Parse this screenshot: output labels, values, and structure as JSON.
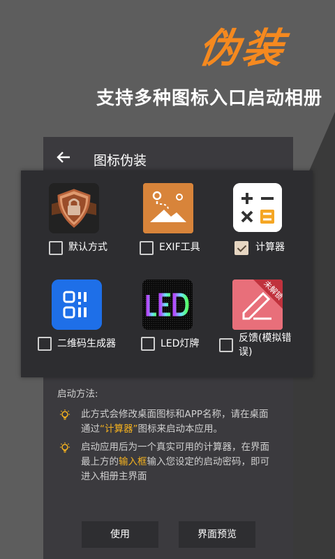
{
  "hero": {
    "title": "伪装",
    "subtitle": "支持多种图标入口启动相册"
  },
  "screen": {
    "title": "图标伪装"
  },
  "icons": [
    {
      "label": "默认方式",
      "checked": false,
      "icon": "shield-lock-icon"
    },
    {
      "label": "EXIF工具",
      "checked": false,
      "icon": "map-image-icon"
    },
    {
      "label": "计算器",
      "checked": true,
      "icon": "calculator-icon"
    },
    {
      "label": "二维码生成器",
      "checked": false,
      "icon": "qr-code-icon"
    },
    {
      "label": "LED灯牌",
      "checked": false,
      "icon": "led-sign-icon"
    },
    {
      "label": "反馈(模拟错误)",
      "label_line1": "反馈(模拟错",
      "label_line2": "误)",
      "checked": false,
      "icon": "feedback-pen-icon",
      "badge": "未解锁"
    }
  ],
  "launch": {
    "heading": "启动方法:",
    "hint1": {
      "pre": "此方式会修改桌面图标和APP名称，请在桌面",
      "line2_pre": "通过",
      "highlight": "“计算器”",
      "line2_post": "图标来启动本应用。"
    },
    "hint2": {
      "line1": "启动应用后为一个真实可用的计算器，在界面",
      "line2_pre": "最上方的",
      "highlight": "输入框",
      "line2_post": "输入您设定的启动密码，即可",
      "line3": "进入相册主界面"
    }
  },
  "buttons": {
    "use": "使用",
    "preview": "界面预览"
  },
  "colors": {
    "accent": "#f5891f",
    "highlight": "#f5b21f",
    "panel": "#2d2d30"
  }
}
